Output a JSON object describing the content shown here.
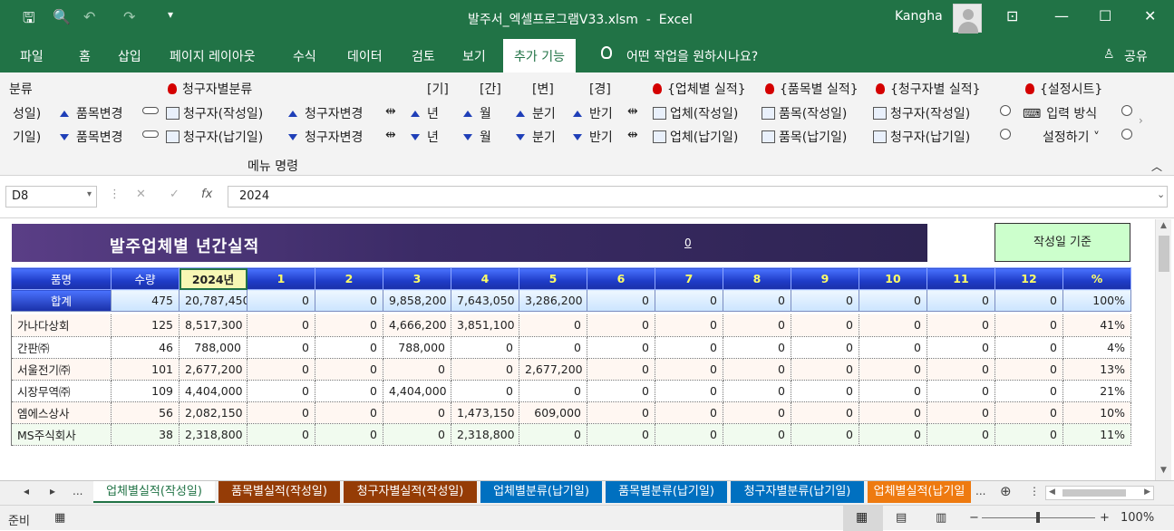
{
  "titlebar": {
    "filename": "발주서_엑셀프로그램V33.xlsm",
    "separator": "-",
    "app": "Excel",
    "user": "Kangha",
    "minimize": "—",
    "restore": "☐",
    "close": "✕",
    "ribbon_display": "⊡"
  },
  "ribbon_tabs": [
    "파일",
    "홈",
    "삽입",
    "페이지 레이아웃",
    "수식",
    "데이터",
    "검토",
    "보기",
    "추가 기능"
  ],
  "tell_me": "어떤 작업을 원하시나요?",
  "share": "공유",
  "ribbon": {
    "col1": [
      "분류",
      "성일)",
      "기일)"
    ],
    "row1": {
      "item_change": "품목변경",
      "client_write": "청구자(작성일)",
      "client_change": "청구자변경",
      "year": "년",
      "month": "월",
      "quarter": "분기",
      "half": "반기",
      "vendor_write": "업체(작성일)",
      "product_write": "품목(작성일)",
      "client2_write": "청구자(작성일)",
      "input_method": "입력 방식"
    },
    "row2": {
      "item_change": "품목변경",
      "client_due": "청구자(납기일)",
      "client_change": "청구자변경",
      "year": "년",
      "month": "월",
      "quarter": "분기",
      "half": "반기",
      "vendor_due": "업체(납기일)",
      "product_due": "품목(납기일)",
      "client2_due": "청구자(납기일)",
      "settings": "설정하기 ˅"
    },
    "headers": {
      "client_class": "청구자별분류",
      "year": "[기]",
      "month": "[간]",
      "quarter": "[변]",
      "half": "[경]",
      "vendor_perf": "{업체별 실적}",
      "product_perf": "{품목별 실적}",
      "client_perf": "{청구자별 실적}",
      "settings_sheet": "{설정시트}"
    },
    "group_label": "메뉴 명령"
  },
  "formula_bar": {
    "name_box": "D8",
    "formula": "2024",
    "cancel": "✕",
    "enter": "✓",
    "fx": "fx"
  },
  "sheet": {
    "title": "발주업체별 년간실적",
    "title_value": "0",
    "criteria": "작성일 기준",
    "headers": [
      "품명",
      "수량",
      "2024년",
      "1",
      "2",
      "3",
      "4",
      "5",
      "6",
      "7",
      "8",
      "9",
      "10",
      "11",
      "12",
      "%"
    ],
    "total": [
      "합계",
      "475",
      "20,787,450",
      "0",
      "0",
      "9,858,200",
      "7,643,050",
      "3,286,200",
      "0",
      "0",
      "0",
      "0",
      "0",
      "0",
      "0",
      "100%"
    ],
    "rows": [
      [
        "가나다상회",
        "125",
        "8,517,300",
        "0",
        "0",
        "4,666,200",
        "3,851,100",
        "0",
        "0",
        "0",
        "0",
        "0",
        "0",
        "0",
        "0",
        "41%"
      ],
      [
        "간판㈜",
        "46",
        "788,000",
        "0",
        "0",
        "788,000",
        "0",
        "0",
        "0",
        "0",
        "0",
        "0",
        "0",
        "0",
        "0",
        "4%"
      ],
      [
        "서울전기㈜",
        "101",
        "2,677,200",
        "0",
        "0",
        "0",
        "0",
        "2,677,200",
        "0",
        "0",
        "0",
        "0",
        "0",
        "0",
        "0",
        "13%"
      ],
      [
        "시장무역㈜",
        "109",
        "4,404,000",
        "0",
        "0",
        "4,404,000",
        "0",
        "0",
        "0",
        "0",
        "0",
        "0",
        "0",
        "0",
        "0",
        "21%"
      ],
      [
        "엠에스상사",
        "56",
        "2,082,150",
        "0",
        "0",
        "0",
        "1,473,150",
        "609,000",
        "0",
        "0",
        "0",
        "0",
        "0",
        "0",
        "0",
        "10%"
      ],
      [
        "MS주식회사",
        "38",
        "2,318,800",
        "0",
        "0",
        "0",
        "2,318,800",
        "0",
        "0",
        "0",
        "0",
        "0",
        "0",
        "0",
        "0",
        "11%"
      ]
    ]
  },
  "sheet_tabs": {
    "nav_first": "◂",
    "nav_next": "▸",
    "more": "...",
    "tabs": [
      "업체별실적(작성일)",
      "품목별실적(작성일)",
      "청구자별실적(작성일)",
      "업체별분류(납기일)",
      "품목별분류(납기일)",
      "청구자별분류(납기일)",
      "업체별실적(납기일"
    ],
    "add": "⊕"
  },
  "statusbar": {
    "ready": "준비",
    "zoom": "100%",
    "minus": "−",
    "plus": "+"
  },
  "colors": {
    "excel_green": "#217346",
    "tab_brown": "#953c06",
    "tab_blue": "#0070c0",
    "tab_orange": "#ee7a10",
    "header_blue": "#1f3cc8",
    "banner_purple": "#3b2b66"
  }
}
